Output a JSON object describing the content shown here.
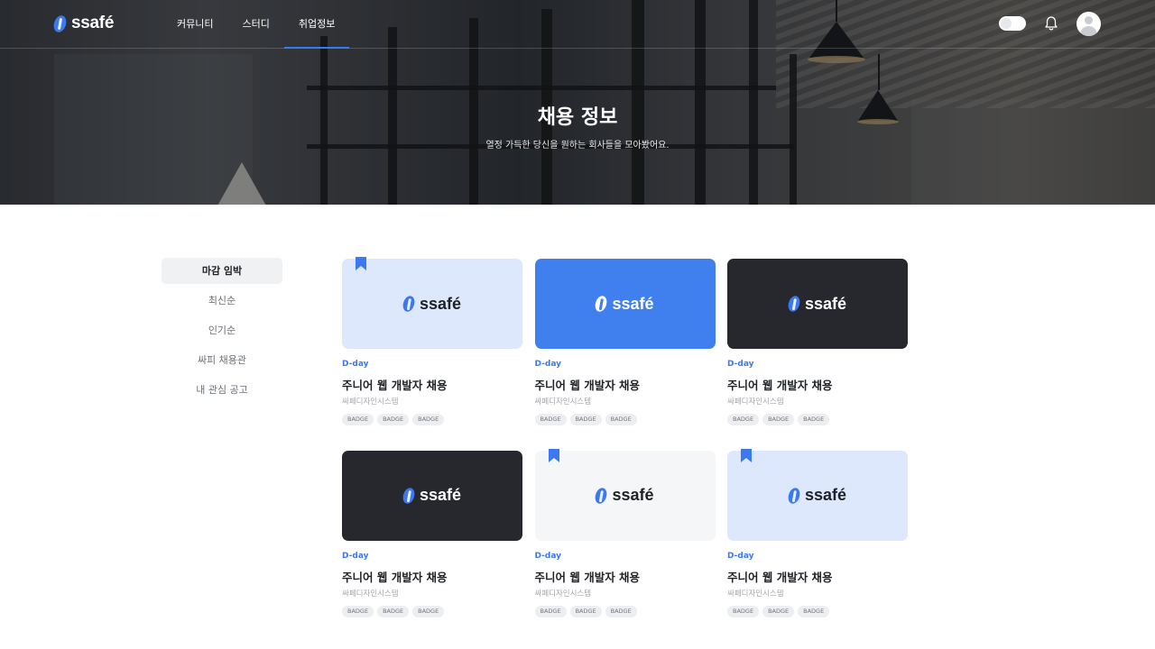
{
  "brand": {
    "name": "ssafé",
    "accent": "#3b78f2"
  },
  "nav": {
    "items": [
      {
        "label": "커뮤니티",
        "active": false
      },
      {
        "label": "스터디",
        "active": false
      },
      {
        "label": "취업정보",
        "active": true
      }
    ]
  },
  "hero": {
    "title": "채용 정보",
    "subtitle": "열정 가득한 당신을 원하는 회사들을 모아봤어요."
  },
  "sidebar": {
    "items": [
      {
        "label": "마감 임박",
        "active": true
      },
      {
        "label": "최신순",
        "active": false
      },
      {
        "label": "인기순",
        "active": false
      },
      {
        "label": "싸피 채용관",
        "active": false
      },
      {
        "label": "내 관심 공고",
        "active": false
      }
    ]
  },
  "cards": [
    {
      "theme": "light-blue",
      "bookmarked": true,
      "dday": "D-day",
      "title": "주니어 웹 개발자 채용",
      "company": "싸페디자인시스템",
      "badges": [
        "BADGE",
        "BADGE",
        "BADGE"
      ]
    },
    {
      "theme": "blue",
      "bookmarked": false,
      "dday": "D-day",
      "title": "주니어 웹 개발자 채용",
      "company": "싸페디자인시스템",
      "badges": [
        "BADGE",
        "BADGE",
        "BADGE"
      ]
    },
    {
      "theme": "dark",
      "bookmarked": false,
      "dday": "D-day",
      "title": "주니어 웹 개발자 채용",
      "company": "싸페디자인시스템",
      "badges": [
        "BADGE",
        "BADGE",
        "BADGE"
      ]
    },
    {
      "theme": "dark",
      "bookmarked": false,
      "dday": "D-day",
      "title": "주니어 웹 개발자 채용",
      "company": "싸페디자인시스템",
      "badges": [
        "BADGE",
        "BADGE",
        "BADGE"
      ]
    },
    {
      "theme": "gray",
      "bookmarked": true,
      "dday": "D-day",
      "title": "주니어 웹 개발자 채용",
      "company": "싸페디자인시스템",
      "badges": [
        "BADGE",
        "BADGE",
        "BADGE"
      ]
    },
    {
      "theme": "light-blue",
      "bookmarked": true,
      "dday": "D-day",
      "title": "주니어 웹 개발자 채용",
      "company": "싸페디자인시스템",
      "badges": [
        "BADGE",
        "BADGE",
        "BADGE"
      ]
    }
  ],
  "themes": {
    "light-blue": {
      "bg": "#dde8fd",
      "text": "#1e2126",
      "bean": "#3b78f2"
    },
    "blue": {
      "bg": "#4080ee",
      "text": "#ffffff",
      "bean": "#ffffff"
    },
    "dark": {
      "bg": "#26282d",
      "text": "#ffffff",
      "bean": "#3b78f2"
    },
    "gray": {
      "bg": "#f5f6f8",
      "text": "#1e2126",
      "bean": "#3b78f2"
    }
  }
}
